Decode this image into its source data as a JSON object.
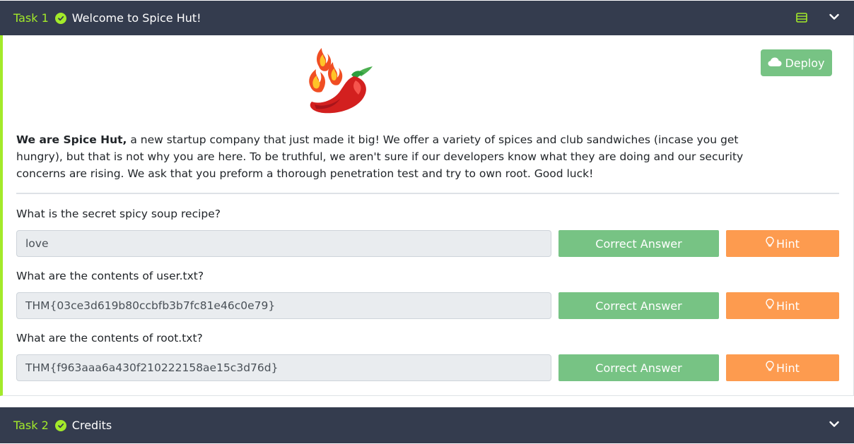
{
  "colors": {
    "header_bg": "#343c4e",
    "accent": "#a3ea2a",
    "success": "#77c384",
    "warning": "#fd9b4f",
    "input_bg": "#e9ecef"
  },
  "task1": {
    "number": "Task 1",
    "title": "Welcome to Spice Hut!",
    "status_icon": "check-circle-icon",
    "deploy_label": "Deploy",
    "intro_bold": "We are Spice Hut,",
    "intro_rest": " a new startup company that just made it big! We offer a variety of spices and club sandwiches (incase you get hungry), but that is not why you are here. To be truthful, we aren't sure if our developers know what they are doing and our security concerns are rising. We ask that you preform a thorough penetration test and try to own root. Good luck!",
    "questions": [
      {
        "text": "What is the secret spicy soup recipe?",
        "answer": "love",
        "submit_label": "Correct Answer",
        "hint_label": "Hint"
      },
      {
        "text": "What are the contents of user.txt?",
        "answer": "THM{03ce3d619b80ccbfb3b7fc81e46c0e79}",
        "submit_label": "Correct Answer",
        "hint_label": "Hint"
      },
      {
        "text": "What are the contents of root.txt?",
        "answer": "THM{f963aaa6a430f210222158ae15c3d76d}",
        "submit_label": "Correct Answer",
        "hint_label": "Hint"
      }
    ]
  },
  "task2": {
    "number": "Task 2",
    "title": "Credits",
    "status_icon": "check-circle-icon"
  }
}
